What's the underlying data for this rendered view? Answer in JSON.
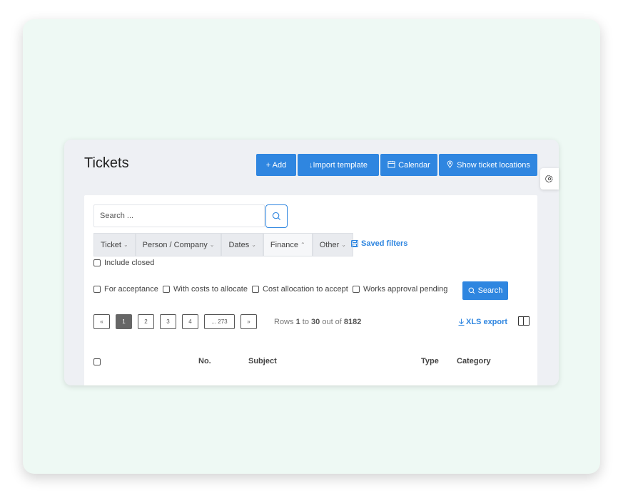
{
  "page": {
    "title": "Tickets"
  },
  "toolbar": {
    "add_label": "+ Add",
    "import_label": "↓Import template",
    "calendar_label": "Calendar",
    "locations_label": "Show ticket locations"
  },
  "search": {
    "placeholder": "Search ..."
  },
  "filter_tabs": [
    {
      "label": "Ticket",
      "chevron": "⌄"
    },
    {
      "label": "Person / Company",
      "chevron": "⌄"
    },
    {
      "label": "Dates",
      "chevron": "⌄"
    },
    {
      "label": "Finance",
      "chevron": "⌃"
    },
    {
      "label": "Other",
      "chevron": "⌄"
    }
  ],
  "saved_filters_label": "Saved filters",
  "checkboxes": {
    "include_closed": "Include closed",
    "for_acceptance": "For acceptance",
    "costs_to_allocate": "With costs to allocate",
    "cost_allocation": "Cost allocation to accept",
    "works_approval": "Works approval pending"
  },
  "search_button_label": "Search",
  "pagination": {
    "prev": "«",
    "pages": [
      "1",
      "2",
      "3",
      "4",
      "... 273"
    ],
    "next": "»",
    "active_page": "1"
  },
  "rows_info": {
    "prefix": "Rows",
    "from": "1",
    "to_word": "to",
    "to": "30",
    "out_word": "out of",
    "total": "8182"
  },
  "xls_export_label": "XLS export",
  "table_headers": {
    "no": "No.",
    "subject": "Subject",
    "type": "Type",
    "category": "Category"
  },
  "colors": {
    "accent": "#2f86e0",
    "background": "#eef9f4",
    "panel": "#eef0f4"
  },
  "icons": [
    "search-icon",
    "calendar-icon",
    "location-pin-icon",
    "gear-icon",
    "save-icon",
    "download-icon",
    "columns-icon"
  ]
}
